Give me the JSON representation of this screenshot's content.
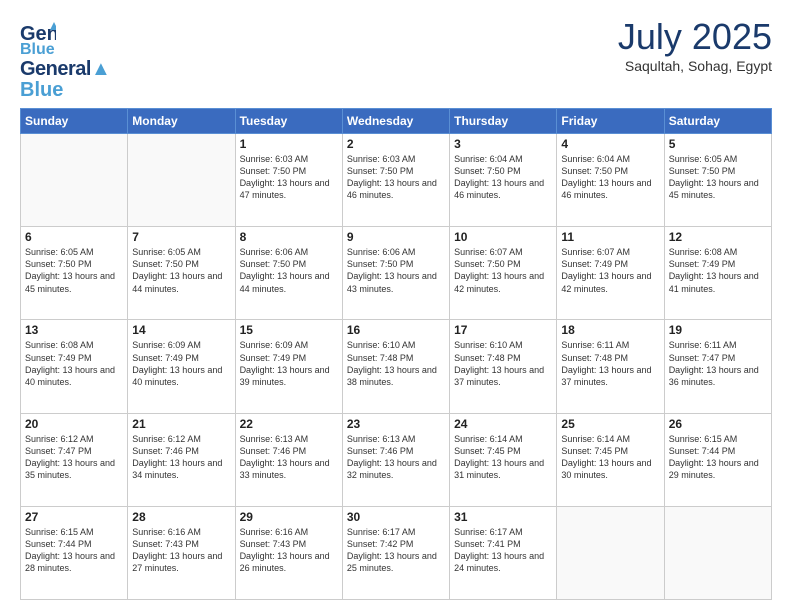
{
  "header": {
    "logo_line1": "General",
    "logo_line2": "Blue",
    "month": "July 2025",
    "location": "Saqultah, Sohag, Egypt"
  },
  "days_of_week": [
    "Sunday",
    "Monday",
    "Tuesday",
    "Wednesday",
    "Thursday",
    "Friday",
    "Saturday"
  ],
  "weeks": [
    [
      {
        "num": "",
        "info": ""
      },
      {
        "num": "",
        "info": ""
      },
      {
        "num": "1",
        "info": "Sunrise: 6:03 AM\nSunset: 7:50 PM\nDaylight: 13 hours and 47 minutes."
      },
      {
        "num": "2",
        "info": "Sunrise: 6:03 AM\nSunset: 7:50 PM\nDaylight: 13 hours and 46 minutes."
      },
      {
        "num": "3",
        "info": "Sunrise: 6:04 AM\nSunset: 7:50 PM\nDaylight: 13 hours and 46 minutes."
      },
      {
        "num": "4",
        "info": "Sunrise: 6:04 AM\nSunset: 7:50 PM\nDaylight: 13 hours and 46 minutes."
      },
      {
        "num": "5",
        "info": "Sunrise: 6:05 AM\nSunset: 7:50 PM\nDaylight: 13 hours and 45 minutes."
      }
    ],
    [
      {
        "num": "6",
        "info": "Sunrise: 6:05 AM\nSunset: 7:50 PM\nDaylight: 13 hours and 45 minutes."
      },
      {
        "num": "7",
        "info": "Sunrise: 6:05 AM\nSunset: 7:50 PM\nDaylight: 13 hours and 44 minutes."
      },
      {
        "num": "8",
        "info": "Sunrise: 6:06 AM\nSunset: 7:50 PM\nDaylight: 13 hours and 44 minutes."
      },
      {
        "num": "9",
        "info": "Sunrise: 6:06 AM\nSunset: 7:50 PM\nDaylight: 13 hours and 43 minutes."
      },
      {
        "num": "10",
        "info": "Sunrise: 6:07 AM\nSunset: 7:50 PM\nDaylight: 13 hours and 42 minutes."
      },
      {
        "num": "11",
        "info": "Sunrise: 6:07 AM\nSunset: 7:49 PM\nDaylight: 13 hours and 42 minutes."
      },
      {
        "num": "12",
        "info": "Sunrise: 6:08 AM\nSunset: 7:49 PM\nDaylight: 13 hours and 41 minutes."
      }
    ],
    [
      {
        "num": "13",
        "info": "Sunrise: 6:08 AM\nSunset: 7:49 PM\nDaylight: 13 hours and 40 minutes."
      },
      {
        "num": "14",
        "info": "Sunrise: 6:09 AM\nSunset: 7:49 PM\nDaylight: 13 hours and 40 minutes."
      },
      {
        "num": "15",
        "info": "Sunrise: 6:09 AM\nSunset: 7:49 PM\nDaylight: 13 hours and 39 minutes."
      },
      {
        "num": "16",
        "info": "Sunrise: 6:10 AM\nSunset: 7:48 PM\nDaylight: 13 hours and 38 minutes."
      },
      {
        "num": "17",
        "info": "Sunrise: 6:10 AM\nSunset: 7:48 PM\nDaylight: 13 hours and 37 minutes."
      },
      {
        "num": "18",
        "info": "Sunrise: 6:11 AM\nSunset: 7:48 PM\nDaylight: 13 hours and 37 minutes."
      },
      {
        "num": "19",
        "info": "Sunrise: 6:11 AM\nSunset: 7:47 PM\nDaylight: 13 hours and 36 minutes."
      }
    ],
    [
      {
        "num": "20",
        "info": "Sunrise: 6:12 AM\nSunset: 7:47 PM\nDaylight: 13 hours and 35 minutes."
      },
      {
        "num": "21",
        "info": "Sunrise: 6:12 AM\nSunset: 7:46 PM\nDaylight: 13 hours and 34 minutes."
      },
      {
        "num": "22",
        "info": "Sunrise: 6:13 AM\nSunset: 7:46 PM\nDaylight: 13 hours and 33 minutes."
      },
      {
        "num": "23",
        "info": "Sunrise: 6:13 AM\nSunset: 7:46 PM\nDaylight: 13 hours and 32 minutes."
      },
      {
        "num": "24",
        "info": "Sunrise: 6:14 AM\nSunset: 7:45 PM\nDaylight: 13 hours and 31 minutes."
      },
      {
        "num": "25",
        "info": "Sunrise: 6:14 AM\nSunset: 7:45 PM\nDaylight: 13 hours and 30 minutes."
      },
      {
        "num": "26",
        "info": "Sunrise: 6:15 AM\nSunset: 7:44 PM\nDaylight: 13 hours and 29 minutes."
      }
    ],
    [
      {
        "num": "27",
        "info": "Sunrise: 6:15 AM\nSunset: 7:44 PM\nDaylight: 13 hours and 28 minutes."
      },
      {
        "num": "28",
        "info": "Sunrise: 6:16 AM\nSunset: 7:43 PM\nDaylight: 13 hours and 27 minutes."
      },
      {
        "num": "29",
        "info": "Sunrise: 6:16 AM\nSunset: 7:43 PM\nDaylight: 13 hours and 26 minutes."
      },
      {
        "num": "30",
        "info": "Sunrise: 6:17 AM\nSunset: 7:42 PM\nDaylight: 13 hours and 25 minutes."
      },
      {
        "num": "31",
        "info": "Sunrise: 6:17 AM\nSunset: 7:41 PM\nDaylight: 13 hours and 24 minutes."
      },
      {
        "num": "",
        "info": ""
      },
      {
        "num": "",
        "info": ""
      }
    ]
  ]
}
